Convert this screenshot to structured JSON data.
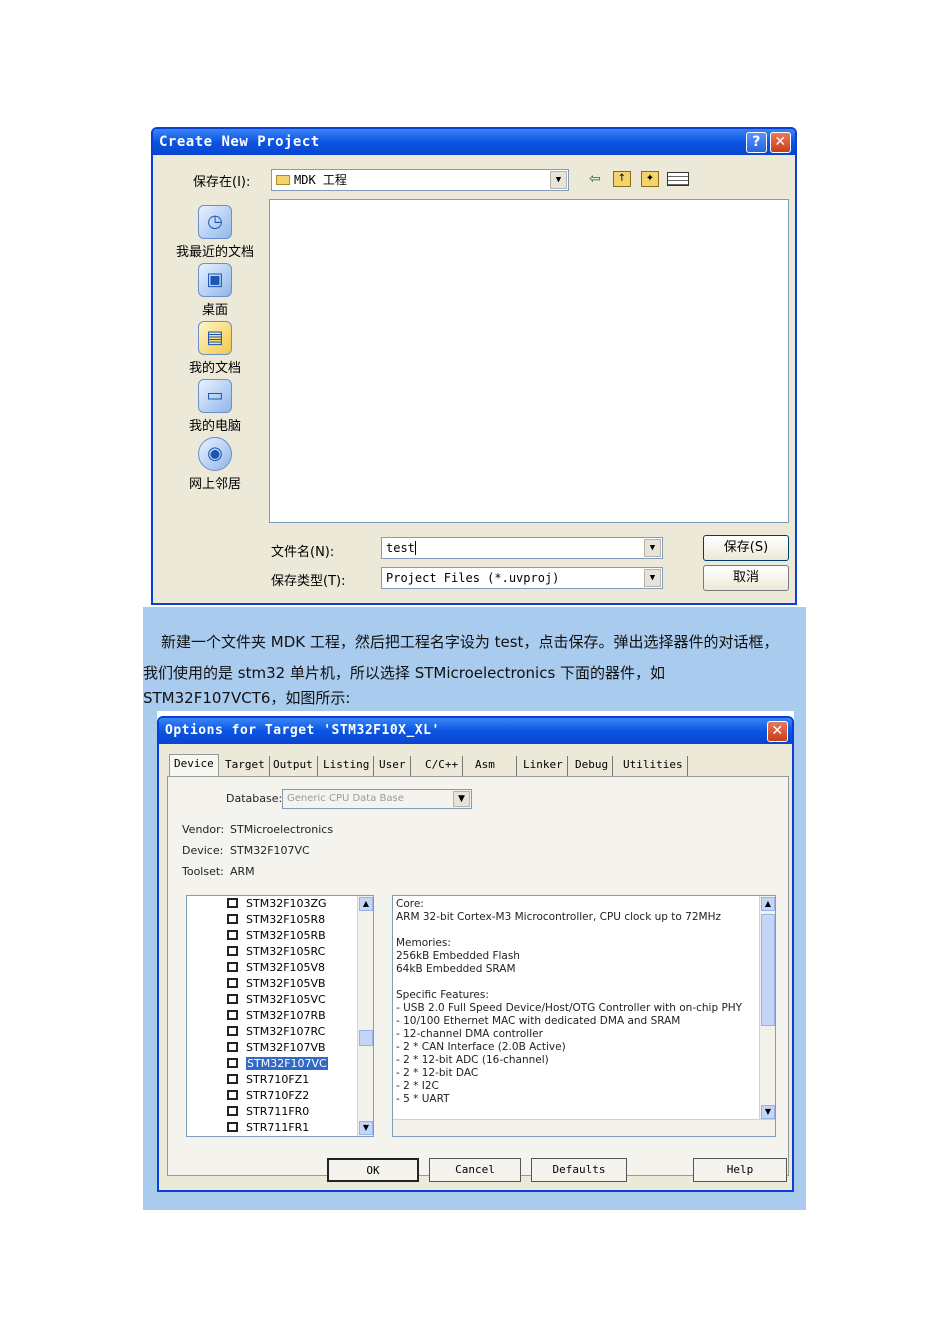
{
  "dialog1": {
    "title": "Create New Project",
    "help_glyph": "?",
    "close_glyph": "✕",
    "save_in_label": "保存在(I):",
    "save_in_value": "MDK 工程",
    "places": [
      "我最近的文档",
      "桌面",
      "我的文档",
      "我的电脑",
      "网上邻居"
    ],
    "filename_label": "文件名(N):",
    "filename_value": "test",
    "filetype_label": "保存类型(T):",
    "filetype_value": "Project Files (*.uvproj)",
    "save_button": "保存(S)",
    "cancel_button": "取消"
  },
  "paragraph": {
    "line1": "新建一个文件夹 MDK 工程，然后把工程名字设为 test，点击保存。弹出选择器件的对话框，",
    "line2": "我们使用的是 stm32 单片机，所以选择 STMicroelectronics 下面的器件，如",
    "line3": "STM32F107VCT6，如图所示:"
  },
  "dialog2": {
    "title": "Options for Target 'STM32F10X_XL'",
    "close_glyph": "✕",
    "tabs": [
      "Device",
      "Target",
      "Output",
      "Listing",
      "User",
      "C/C++",
      "Asm",
      "Linker",
      "Debug",
      "Utilities"
    ],
    "database_label": "Database:",
    "database_value": "Generic CPU Data Base",
    "vendor_label": "Vendor:",
    "vendor_value": "STMicroelectronics",
    "device_label": "Device:",
    "device_value": "STM32F107VC",
    "toolset_label": "Toolset:",
    "toolset_value": "ARM",
    "devices": [
      "STM32F103ZG",
      "STM32F105R8",
      "STM32F105RB",
      "STM32F105RC",
      "STM32F105V8",
      "STM32F105VB",
      "STM32F105VC",
      "STM32F107RB",
      "STM32F107RC",
      "STM32F107VB",
      "STM32F107VC",
      "STR710FZ1",
      "STR710FZ2",
      "STR711FR0",
      "STR711FR1"
    ],
    "selected_device": "STM32F107VC",
    "description": [
      "Core:",
      " ARM 32-bit Cortex-M3 Microcontroller, CPU clock up to 72MHz",
      "",
      "Memories:",
      " 256kB Embedded Flash",
      " 64kB Embedded SRAM",
      "",
      "Specific Features:",
      "- USB 2.0 Full Speed Device/Host/OTG Controller with on-chip PHY",
      "- 10/100 Ethernet MAC with dedicated DMA and SRAM",
      "- 12-channel DMA controller",
      "- 2 * CAN Interface (2.0B Active)",
      "- 2 * 12-bit ADC (16-channel)",
      "- 2 * 12-bit DAC",
      "- 2 * I2C",
      "- 5 * UART"
    ],
    "ok_button": "OK",
    "cancel_button": "Cancel",
    "defaults_button": "Defaults",
    "help_button": "Help"
  },
  "colors": {
    "title_blue": "#0b54e3",
    "dialog_face": "#ece9d8",
    "band_blue": "#a9cbee",
    "selection": "#316ac5"
  }
}
